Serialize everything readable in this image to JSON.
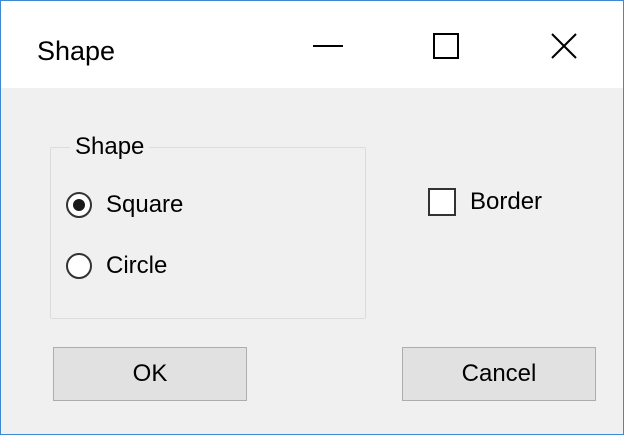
{
  "window": {
    "title": "Shape",
    "border_color": "#3c8ad6",
    "controls": {
      "minimize_icon": "minimize-icon",
      "maximize_icon": "maximize-icon",
      "close_icon": "close-icon"
    }
  },
  "shape_group": {
    "label": "Shape",
    "options": [
      {
        "label": "Square",
        "selected": true
      },
      {
        "label": "Circle",
        "selected": false
      }
    ]
  },
  "border_checkbox": {
    "label": "Border",
    "checked": false
  },
  "buttons": {
    "ok_label": "OK",
    "cancel_label": "Cancel"
  }
}
